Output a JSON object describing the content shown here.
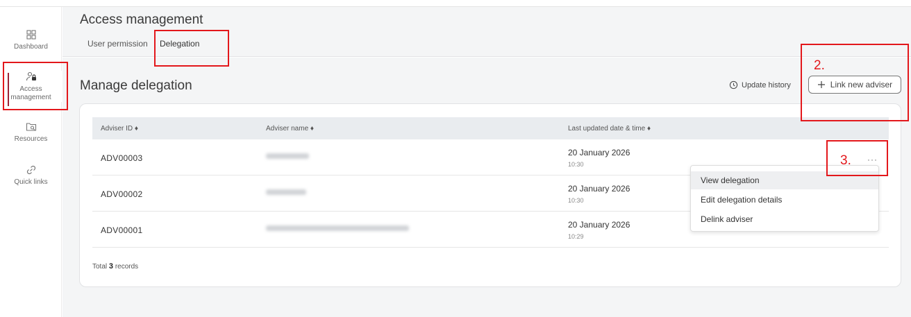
{
  "sidebar": {
    "items": [
      {
        "label": "Dashboard",
        "icon": "grid-icon"
      },
      {
        "label": "Access management",
        "icon": "user-lock-icon"
      },
      {
        "label": "Resources",
        "icon": "folder-search-icon"
      },
      {
        "label": "Quick links",
        "icon": "link-icon"
      }
    ]
  },
  "header": {
    "title": "Access management",
    "tabs": [
      {
        "label": "User permission"
      },
      {
        "label": "Delegation"
      }
    ]
  },
  "main": {
    "section_title": "Manage delegation",
    "update_history": "Update history",
    "link_button": "Link new adviser"
  },
  "table": {
    "columns": [
      "Adviser ID ♦",
      "Adviser name ♦",
      "Last updated date & time ♦"
    ],
    "rows": [
      {
        "id": "ADV00003",
        "date": "20 January 2026",
        "time": "10:30"
      },
      {
        "id": "ADV00002",
        "date": "20 January 2026",
        "time": "10:30"
      },
      {
        "id": "ADV00001",
        "date": "20 January 2026",
        "time": "10:29"
      }
    ],
    "more": "···",
    "total_prefix": "Total",
    "total_count": "3",
    "total_suffix": "records"
  },
  "menu": {
    "items": [
      "View delegation",
      "Edit delegation details",
      "Delink adviser"
    ]
  },
  "annotations": {
    "step2": "2.",
    "step3": "3."
  },
  "colors": {
    "accent": "#9b2335",
    "annotation": "#e3171b",
    "header_bg": "#f4f5f6"
  }
}
